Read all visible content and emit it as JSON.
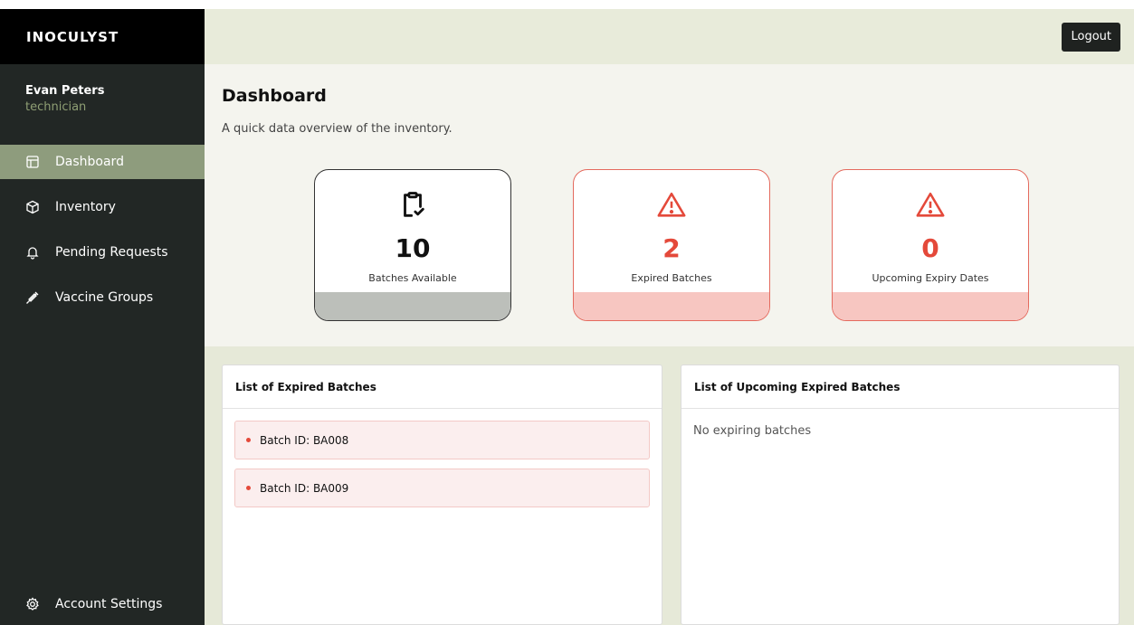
{
  "brand": "INOCULYST",
  "user": {
    "name": "Evan Peters",
    "role": "technician"
  },
  "nav": {
    "items": [
      {
        "label": "Dashboard",
        "icon": "layout-icon",
        "active": true
      },
      {
        "label": "Inventory",
        "icon": "box-icon"
      },
      {
        "label": "Pending Requests",
        "icon": "bell-icon"
      },
      {
        "label": "Vaccine Groups",
        "icon": "syringe-icon"
      }
    ],
    "account": {
      "label": "Account Settings",
      "icon": "gear-icon"
    }
  },
  "topbar": {
    "logout_label": "Logout"
  },
  "page": {
    "title": "Dashboard",
    "subtitle": "A quick data overview of the inventory."
  },
  "cards": [
    {
      "value": "10",
      "label": "Batches Available",
      "icon": "clipboard-check-icon"
    },
    {
      "value": "2",
      "label": "Expired Batches",
      "icon": "warning-icon"
    },
    {
      "value": "0",
      "label": "Upcoming Expiry Dates",
      "icon": "warning-icon"
    }
  ],
  "expired": {
    "title": "List of Expired Batches",
    "items": [
      "Batch ID: BA008",
      "Batch ID: BA009"
    ]
  },
  "upcoming": {
    "title": "List of Upcoming Expired Batches",
    "empty": "No expiring batches"
  },
  "colors": {
    "sidebar": "#222725",
    "active": "#8e9c7d",
    "danger": "#e4493a",
    "accent_text": "#8f9f74"
  }
}
